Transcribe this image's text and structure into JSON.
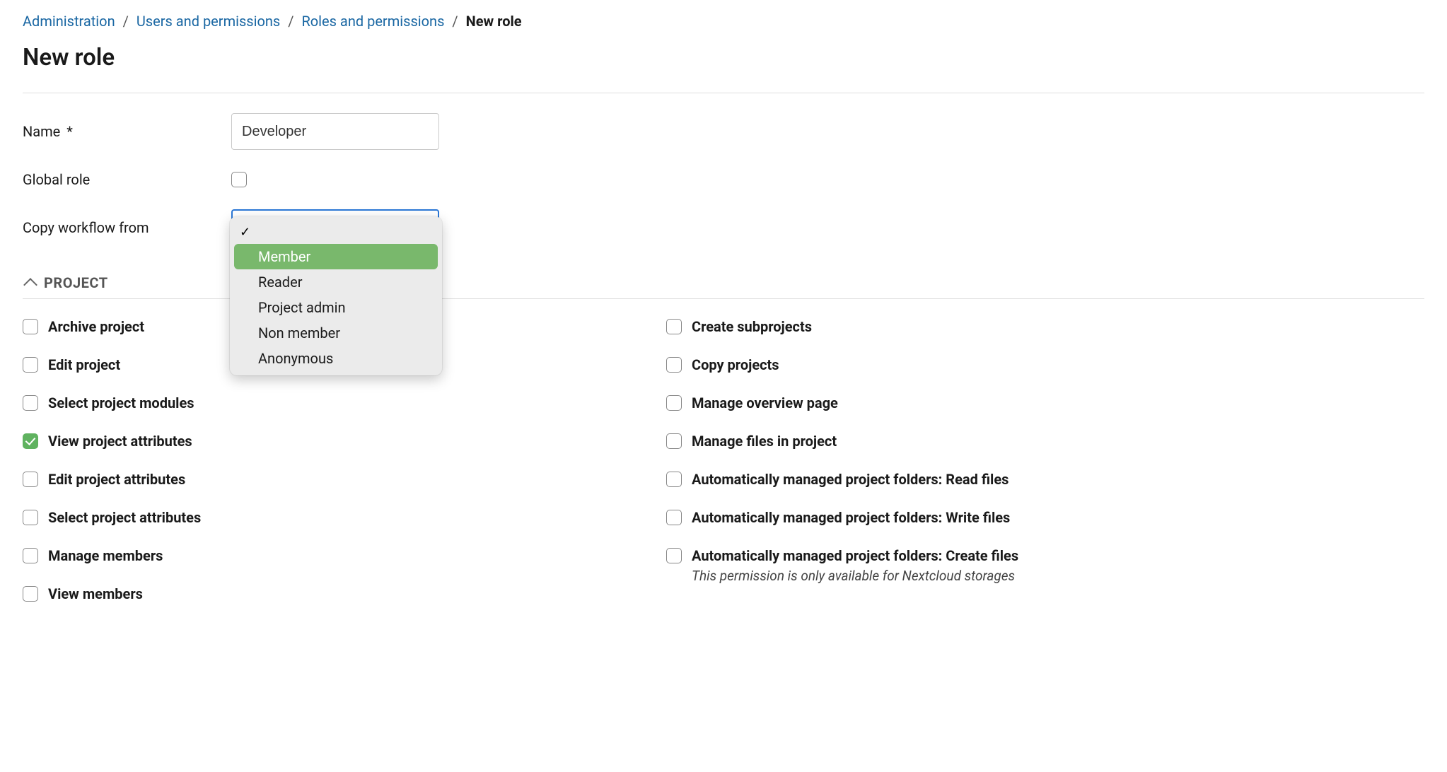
{
  "breadcrumb": {
    "items": [
      "Administration",
      "Users and permissions",
      "Roles and permissions"
    ],
    "current": "New role"
  },
  "page_title": "New role",
  "form": {
    "name_label": "Name",
    "name_required_marker": "*",
    "name_value": "Developer",
    "global_role_label": "Global role",
    "global_role_checked": false,
    "copy_workflow_label": "Copy workflow from",
    "copy_workflow_options": [
      {
        "label": "",
        "selected": true
      },
      {
        "label": "Member",
        "highlighted": true
      },
      {
        "label": "Reader"
      },
      {
        "label": "Project admin"
      },
      {
        "label": "Non member"
      },
      {
        "label": "Anonymous"
      }
    ]
  },
  "section": {
    "title": "PROJECT"
  },
  "permissions": {
    "left": [
      {
        "label": "Archive project",
        "checked": false
      },
      {
        "label": "Edit project",
        "checked": false
      },
      {
        "label": "Select project modules",
        "checked": false
      },
      {
        "label": "View project attributes",
        "checked": true
      },
      {
        "label": "Edit project attributes",
        "checked": false
      },
      {
        "label": "Select project attributes",
        "checked": false
      },
      {
        "label": "Manage members",
        "checked": false
      },
      {
        "label": "View members",
        "checked": false
      }
    ],
    "right": [
      {
        "label": "Create subprojects",
        "checked": false
      },
      {
        "label": "Copy projects",
        "checked": false
      },
      {
        "label": "Manage overview page",
        "checked": false
      },
      {
        "label": "Manage files in project",
        "checked": false
      },
      {
        "label": "Automatically managed project folders: Read files",
        "checked": false
      },
      {
        "label": "Automatically managed project folders: Write files",
        "checked": false
      },
      {
        "label": "Automatically managed project folders: Create files",
        "checked": false,
        "note": "This permission is only available for Nextcloud storages"
      }
    ]
  }
}
